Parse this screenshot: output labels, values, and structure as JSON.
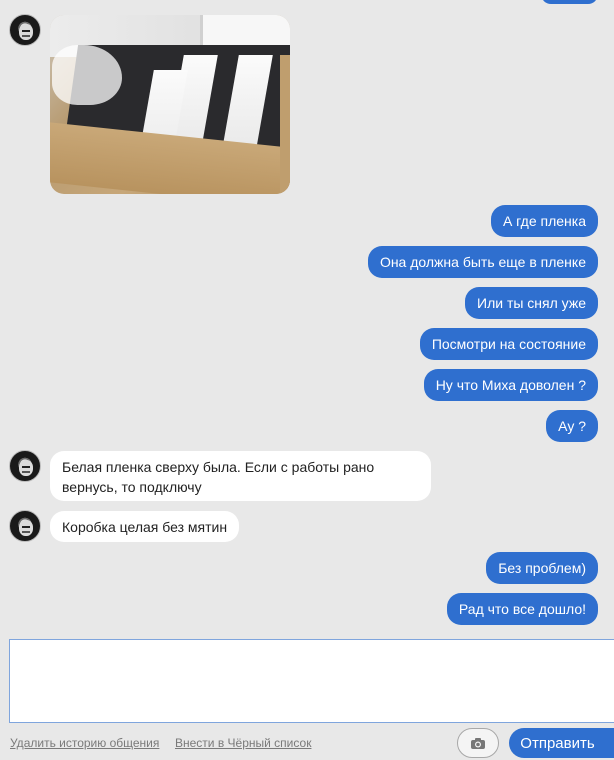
{
  "messages": {
    "out": [
      "А где пленка",
      "Она должна быть еще в пленке",
      "Или ты снял уже",
      "Посмотри на состояние",
      "Ну что Миха доволен ?",
      "Ау ?",
      "Без проблем)",
      "Рад что все дошло!"
    ],
    "in": [
      "Белая пленка сверху была. Если с работы рано",
      "вернусь, то подключу",
      "Коробка целая без мятин"
    ]
  },
  "composer": {
    "value": "",
    "placeholder": ""
  },
  "footer": {
    "delete_history": "Удалить историю общения",
    "blacklist": "Внести в Чёрный список",
    "send_label": "Отправить"
  },
  "icons": {
    "camera": "camera-icon"
  },
  "colors": {
    "accent": "#2f6fcf",
    "background": "#e8e8e8",
    "incoming_bubble": "#ffffff"
  }
}
